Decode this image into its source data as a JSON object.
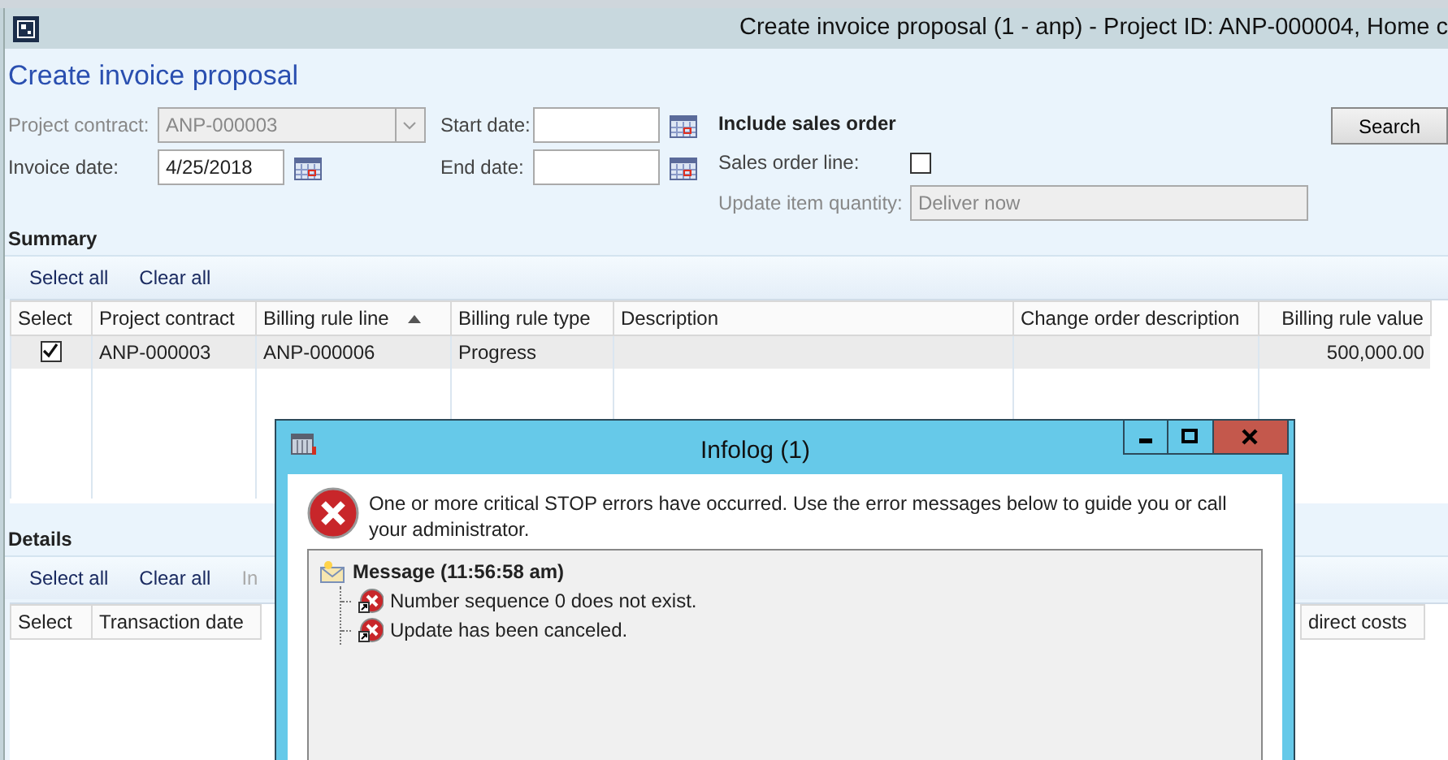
{
  "window": {
    "title": "Create invoice proposal (1 - anp) - Project ID: ANP-000004, Home c"
  },
  "form": {
    "heading": "Create invoice proposal",
    "fields": [
      {
        "label": "Project contract:",
        "value": "ANP-000003",
        "kind": "combo",
        "disabled": true
      },
      {
        "label": "Invoice date:",
        "value": "4/25/2018",
        "kind": "date",
        "disabled": false
      }
    ],
    "date_range": [
      {
        "label": "Start date:",
        "kind": "date"
      },
      {
        "label": "End date:",
        "kind": "date"
      }
    ],
    "sales_order": {
      "heading": "Include sales order",
      "line_label": "Sales order line:",
      "line_checked": false,
      "quantity_label": "Update item quantity:",
      "quantity_value": "Deliver now",
      "quantity_disabled": true
    },
    "search_button": "Search"
  },
  "summary": {
    "title": "Summary",
    "toolbar": [
      {
        "label": "Select all",
        "disabled": false
      },
      {
        "label": "Clear all",
        "disabled": false
      }
    ],
    "columns": [
      {
        "label": "Select",
        "sorted": false
      },
      {
        "label": "Project contract",
        "sorted": false
      },
      {
        "label": "Billing rule line",
        "sorted": true
      },
      {
        "label": "Billing rule type",
        "sorted": false
      },
      {
        "label": "Description",
        "sorted": false
      },
      {
        "label": "Change order description",
        "sorted": false
      },
      {
        "label": "Billing rule value",
        "sorted": false
      }
    ],
    "rows": [
      {
        "checked": true,
        "selected": true,
        "project_contract": "ANP-000003",
        "billing_rule_line": "ANP-000006",
        "billing_rule_type": "Progress",
        "billing_rule_value": "500,000.00"
      }
    ]
  },
  "details": {
    "title": "Details",
    "toolbar": [
      {
        "label": "Select all",
        "disabled": false
      },
      {
        "label": "Clear all",
        "disabled": false
      },
      {
        "label": "In",
        "disabled": true
      }
    ],
    "columns": [
      {
        "label": "Select"
      },
      {
        "label": "Transaction date"
      },
      {
        "label": "direct costs"
      }
    ]
  },
  "infolog": {
    "title": "Infolog (1)",
    "summary": "One or more critical STOP errors have occurred. Use the error messages below to guide you or call your administrator.",
    "tree": [
      {
        "kind": "message",
        "text": "Message (11:56:58 am)",
        "children": [
          {
            "kind": "error",
            "text": "Number sequence 0 does not exist."
          },
          {
            "kind": "error",
            "text": "Update has been canceled."
          }
        ]
      }
    ]
  }
}
